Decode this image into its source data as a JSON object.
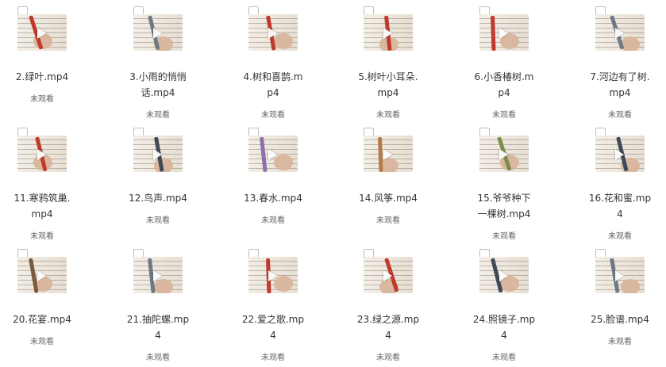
{
  "status_label": "未观看",
  "videos": [
    {
      "title": "2.绿叶.mp4",
      "status": "未观看",
      "pen_color": "#c0392b"
    },
    {
      "title": "3.小雨的悄悄话.mp4",
      "status": "未观看",
      "pen_color": "#6d7a86"
    },
    {
      "title": "4.树和喜鹊.mp4",
      "status": "未观看",
      "pen_color": "#c0392b"
    },
    {
      "title": "5.树叶小耳朵.mp4",
      "status": "未观看",
      "pen_color": "#c0392b"
    },
    {
      "title": "6.小香椿树.mp4",
      "status": "未观看",
      "pen_color": "#c0392b"
    },
    {
      "title": "7.河边有了树.mp4",
      "status": "未观看",
      "pen_color": "#6d7a86"
    },
    {
      "title": "11.寒鸦筑巢.mp4",
      "status": "未观看",
      "pen_color": "#c0392b"
    },
    {
      "title": "12.鸟声.mp4",
      "status": "未观看",
      "pen_color": "#3e4a57"
    },
    {
      "title": "13.春水.mp4",
      "status": "未观看",
      "pen_color": "#8e6fa8"
    },
    {
      "title": "14.风筝.mp4",
      "status": "未观看",
      "pen_color": "#b47a4a"
    },
    {
      "title": "15.爷爷种下一棵树.mp4",
      "status": "未观看",
      "pen_color": "#7a8f4a"
    },
    {
      "title": "16.花和蜜.mp4",
      "status": "未观看",
      "pen_color": "#3e4a57"
    },
    {
      "title": "20.花宴.mp4",
      "status": "未观看",
      "pen_color": "#7a5a3a"
    },
    {
      "title": "21.抽陀螺.mp4",
      "status": "未观看",
      "pen_color": "#6d7a86"
    },
    {
      "title": "22.爱之歌.mp4",
      "status": "未观看",
      "pen_color": "#c0392b"
    },
    {
      "title": "23.绿之源.mp4",
      "status": "未观看",
      "pen_color": "#c0392b"
    },
    {
      "title": "24.照镜子.mp4",
      "status": "未观看",
      "pen_color": "#3e4a57"
    },
    {
      "title": "25.脸谱.mp4",
      "status": "未观看",
      "pen_color": "#6d7a86"
    }
  ]
}
